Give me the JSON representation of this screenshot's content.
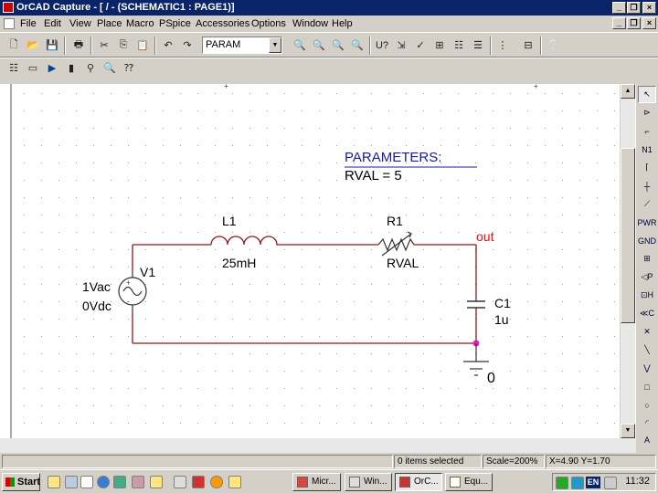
{
  "window": {
    "title": "OrCAD Capture - [ / - (SCHEMATIC1 : PAGE1)]",
    "minimize_glyph": "_",
    "restore_glyph": "❐",
    "close_glyph": "×"
  },
  "menu": {
    "items": [
      "File",
      "Edit",
      "View",
      "Place",
      "Macro",
      "PSpice",
      "Accessories",
      "Options",
      "Window",
      "Help"
    ]
  },
  "toolbar": {
    "part_combo_value": "PARAM"
  },
  "schematic": {
    "params_title": "PARAMETERS:",
    "params_value": "RVAL = 5",
    "inductor_ref": "L1",
    "inductor_value": "25mH",
    "resistor_ref": "R1",
    "resistor_value": "RVAL",
    "net_label": "out",
    "source_ref": "V1",
    "source_ac": "1Vac",
    "source_dc": "0Vdc",
    "cap_ref": "C1",
    "cap_value": "1u",
    "ground_label": "0",
    "wire_color": "#8b1a1a",
    "net_label_color": "#d11",
    "param_color": "#1a1aa0",
    "junction_color": "#e020c0"
  },
  "status": {
    "selection": "0 items selected",
    "scale": "Scale=200%",
    "coords": "X=4.90  Y=1.70"
  },
  "taskbar": {
    "start_label": "Start",
    "tasks": [
      "Micr...",
      "Win...",
      "OrC...",
      "Equ..."
    ],
    "lang": "EN",
    "clock": "11:32"
  }
}
